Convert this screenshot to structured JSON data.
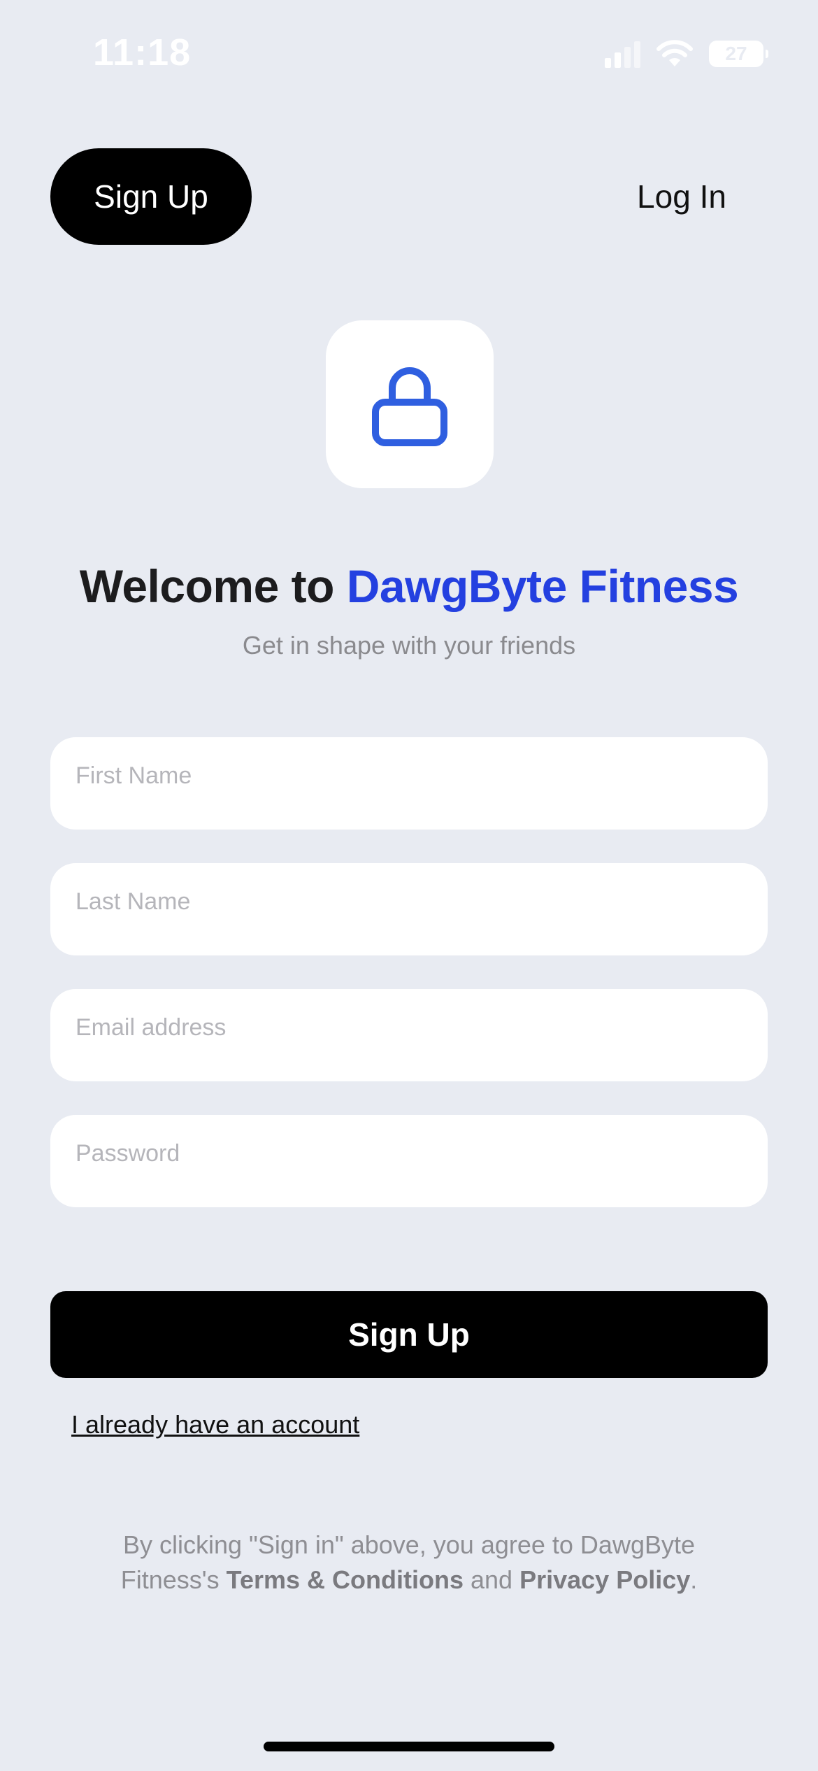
{
  "status_bar": {
    "time": "11:18",
    "battery": "27",
    "icons": [
      "cellular-signal-icon",
      "wifi-icon",
      "battery-icon"
    ]
  },
  "tabs": {
    "signup_label": "Sign Up",
    "login_label": "Log In"
  },
  "hero": {
    "icon": "lock-icon",
    "title_prefix": "Welcome to ",
    "title_brand": "DawgByte Fitness",
    "subtitle": "Get in shape with your friends"
  },
  "form": {
    "first_name": {
      "value": "",
      "placeholder": "First Name"
    },
    "last_name": {
      "value": "",
      "placeholder": "Last Name"
    },
    "email": {
      "value": "",
      "placeholder": "Email address"
    },
    "password": {
      "value": "",
      "placeholder": "Password"
    },
    "submit_label": "Sign Up",
    "existing_account_link": "I already have an account"
  },
  "legal": {
    "part1": "By clicking \"Sign in\" above, you agree to DawgByte Fitness's ",
    "terms": "Terms & Conditions",
    "part2": " and ",
    "privacy": "Privacy Policy",
    "part3": "."
  },
  "colors": {
    "background": "#e8ebf2",
    "brand_blue": "#2440e0",
    "lock_blue": "#2f5fe0",
    "button_black": "#000000"
  }
}
